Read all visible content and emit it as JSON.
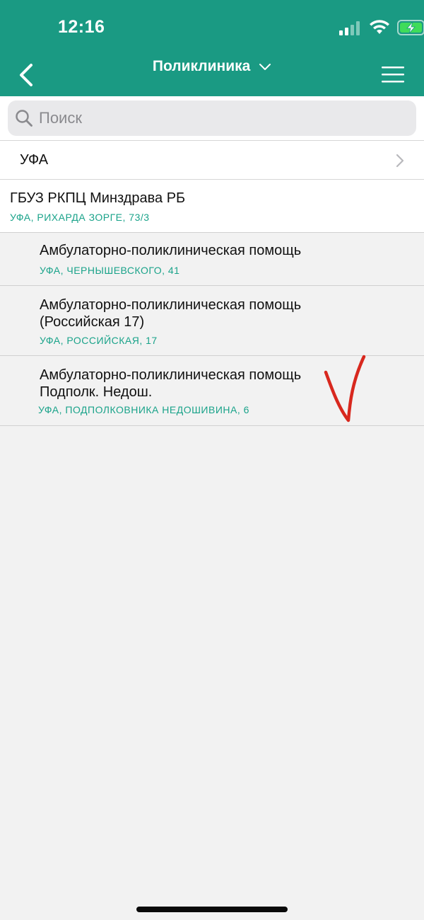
{
  "status_bar": {
    "time": "12:16"
  },
  "header": {
    "title": "Поликлиника",
    "back_icon": "chevron-left-icon",
    "menu_icon": "hamburger-menu-icon",
    "background_color": "#1a9a83"
  },
  "search": {
    "placeholder": "Поиск",
    "value": ""
  },
  "city": {
    "label": "УФА"
  },
  "organization": {
    "name": "ГБУЗ РКПЦ Минздрава РБ",
    "address": "УФА, РИХАРДА ЗОРГЕ, 73/3"
  },
  "departments": [
    {
      "line1": "Амбулаторно-поликлиническая помощь",
      "line2": "",
      "address": "УФА, ЧЕРНЫШЕВСКОГО, 41"
    },
    {
      "line1": "Амбулаторно-поликлиническая помощь",
      "line2": "(Российская 17)",
      "address": "УФА, РОССИЙСКАЯ, 17"
    },
    {
      "line1": "Амбулаторно-поликлиническая помощь",
      "line2": "Подполк. Недош.",
      "address": "УФА, ПОДПОЛКОВНИКА НЕДОШИВИНА, 6"
    }
  ],
  "colors": {
    "accent": "#1a9a83",
    "address_text": "#1aa38a",
    "annotation": "#d8281e"
  }
}
